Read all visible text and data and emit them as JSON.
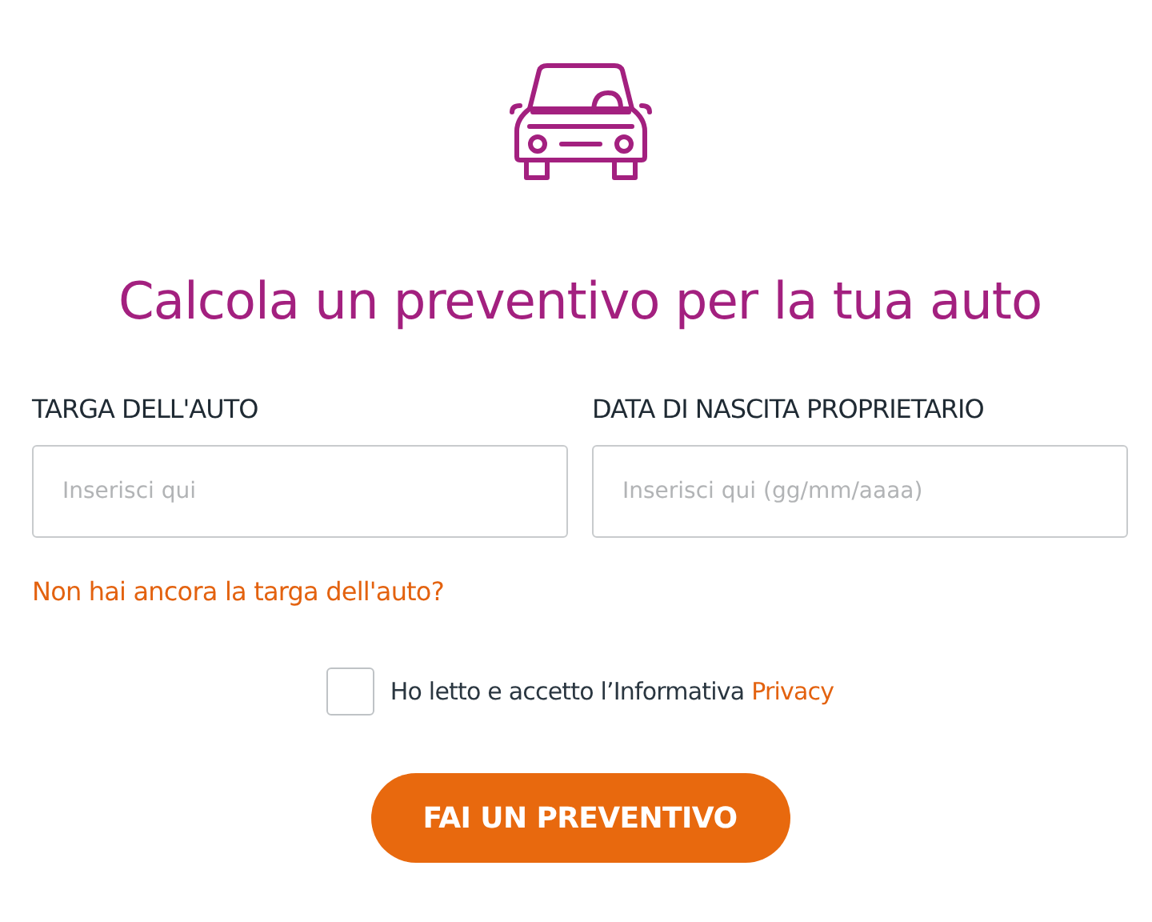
{
  "title": "Calcola un preventivo per la tua auto",
  "fields": [
    {
      "label": "TARGA DELL'AUTO",
      "placeholder": "Inserisci qui"
    },
    {
      "label": "DATA DI NASCITA PROPRIETARIO",
      "placeholder": "Inserisci qui (gg/mm/aaaa)"
    }
  ],
  "plate_link": "Non hai ancora la targa dell'auto?",
  "consent": {
    "text": "Ho letto e accetto l’Informativa ",
    "link": "Privacy",
    "checked": false
  },
  "submit": "FAI UN PREVENTIVO"
}
